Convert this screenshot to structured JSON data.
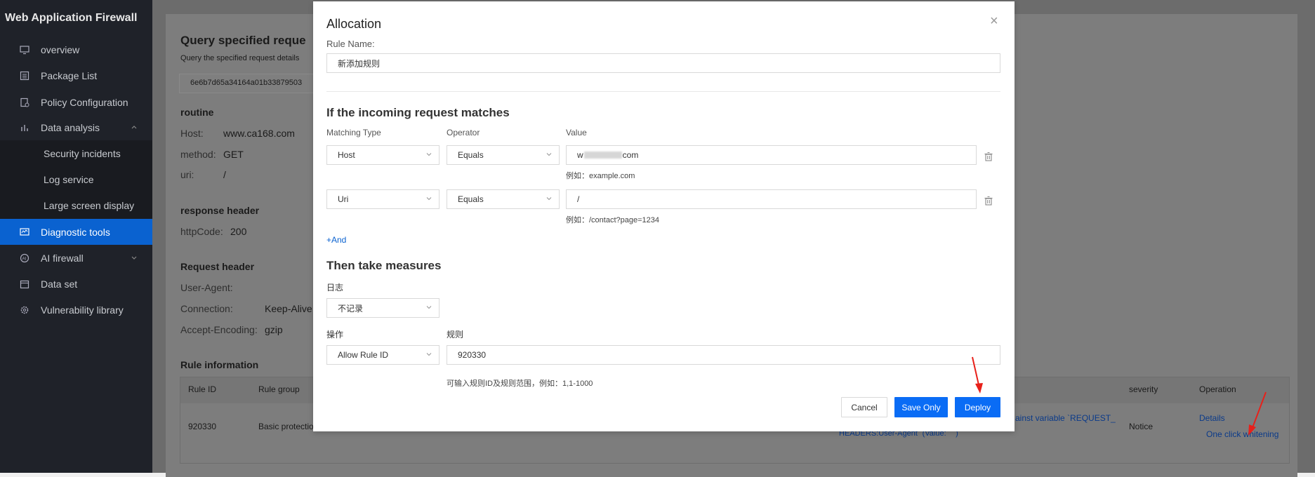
{
  "sidebar": {
    "brand": "Web Application Firewall",
    "items": [
      {
        "label": "overview",
        "icon": "monitor-icon"
      },
      {
        "label": "Package List",
        "icon": "list-icon"
      },
      {
        "label": "Policy Configuration",
        "icon": "policy-icon"
      },
      {
        "label": "Data analysis",
        "icon": "chart-icon"
      },
      {
        "label": "Diagnostic tools",
        "icon": "diagnostic-icon"
      },
      {
        "label": "AI firewall",
        "icon": "ai-icon"
      },
      {
        "label": "Data set",
        "icon": "calendar-icon"
      },
      {
        "label": "Vulnerability library",
        "icon": "gear-icon"
      }
    ],
    "subitems": [
      "Security incidents",
      "Log service",
      "Large screen display"
    ]
  },
  "background": {
    "title": "Query specified reque",
    "subtitle": "Query the specified request details",
    "request_id": "6e6b7d65a34164a01b33879503",
    "routine": {
      "heading": "routine",
      "host_label": "Host:",
      "host_value": "www.ca168.com",
      "method_label": "method:",
      "method_value": "GET",
      "uri_label": "uri:",
      "uri_value": "/"
    },
    "response": {
      "heading": "response header",
      "code_label": "httpCode:",
      "code_value": "200"
    },
    "request": {
      "heading": "Request header",
      "ua_label": "User-Agent:",
      "conn_label": "Connection:",
      "conn_value": "Keep-Alive",
      "enc_label": "Accept-Encoding:",
      "enc_value": "gzip"
    },
    "rule_info": {
      "heading": "Rule information",
      "col_rule_id": "Rule ID",
      "col_rule_group": "Rule group",
      "col_severity": "severity",
      "col_operation": "Operation",
      "rule_id": "920330",
      "rule_group": "Basic protectio",
      "desc_line1": "ainst variable `REQUEST_",
      "desc_line2": "HEADERS:User-Agent` (Value: `` )",
      "severity": "Notice",
      "details": "Details",
      "whitening": "One click whitening"
    }
  },
  "modal": {
    "title": "Allocation",
    "rule_name_label": "Rule Name:",
    "rule_name_value": "新添加规则",
    "match_heading": "If the incoming request matches",
    "col_matching_type": "Matching Type",
    "col_operator": "Operator",
    "col_value": "Value",
    "conditions": [
      {
        "type": "Host",
        "operator": "Equals",
        "value_prefix": "w",
        "value_suffix": "com",
        "hint": "例如：example.com"
      },
      {
        "type": "Uri",
        "operator": "Equals",
        "value": "/",
        "hint": "例如：/contact?page=1234"
      }
    ],
    "add_and": "+And",
    "measures_heading": "Then take measures",
    "log_label": "日志",
    "log_value": "不记录",
    "action_label": "操作",
    "action_value": "Allow Rule ID",
    "rule_label": "规则",
    "rule_value": "920330",
    "rule_hint": "可输入规则ID及规则范围，例如：1,1-1000",
    "buttons": {
      "cancel": "Cancel",
      "save_only": "Save Only",
      "deploy": "Deploy"
    }
  },
  "colors": {
    "accent": "#0a6cf5",
    "sidebar_bg": "#1f2229",
    "active_nav": "#0a62d0",
    "annotation_arrow": "#e8201a"
  }
}
